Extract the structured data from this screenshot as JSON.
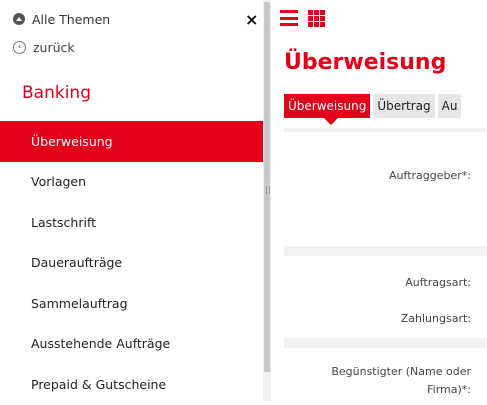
{
  "sidebar": {
    "all_themes": "Alle Themen",
    "close": "×",
    "back": "zurück",
    "back_icon": "‹",
    "section_title": "Banking",
    "items": [
      {
        "label": "Überweisung",
        "active": true
      },
      {
        "label": "Vorlagen"
      },
      {
        "label": "Lastschrift"
      },
      {
        "label": "Daueraufträge"
      },
      {
        "label": "Sammelauftrag"
      },
      {
        "label": "Ausstehende Aufträge"
      },
      {
        "label": "Prepaid & Gutscheine"
      }
    ]
  },
  "main": {
    "page_title": "Überweisung",
    "tabs": [
      {
        "label": "Überweisung",
        "active": true
      },
      {
        "label": "Übertrag"
      },
      {
        "label": "Au"
      }
    ],
    "fields": {
      "auftraggeber": "Auftraggeber*:",
      "auftragsart": "Auftragsart:",
      "zahlungsart": "Zahlungsart:",
      "beguenstigter_1": "Begünstigter (Name oder",
      "beguenstigter_2": "Firma)*:"
    }
  },
  "colors": {
    "accent": "#e2001a"
  },
  "icons": [
    "info-circle-icon",
    "close-icon",
    "back-arrow-icon",
    "hamburger-menu-icon",
    "grid-menu-icon"
  ]
}
